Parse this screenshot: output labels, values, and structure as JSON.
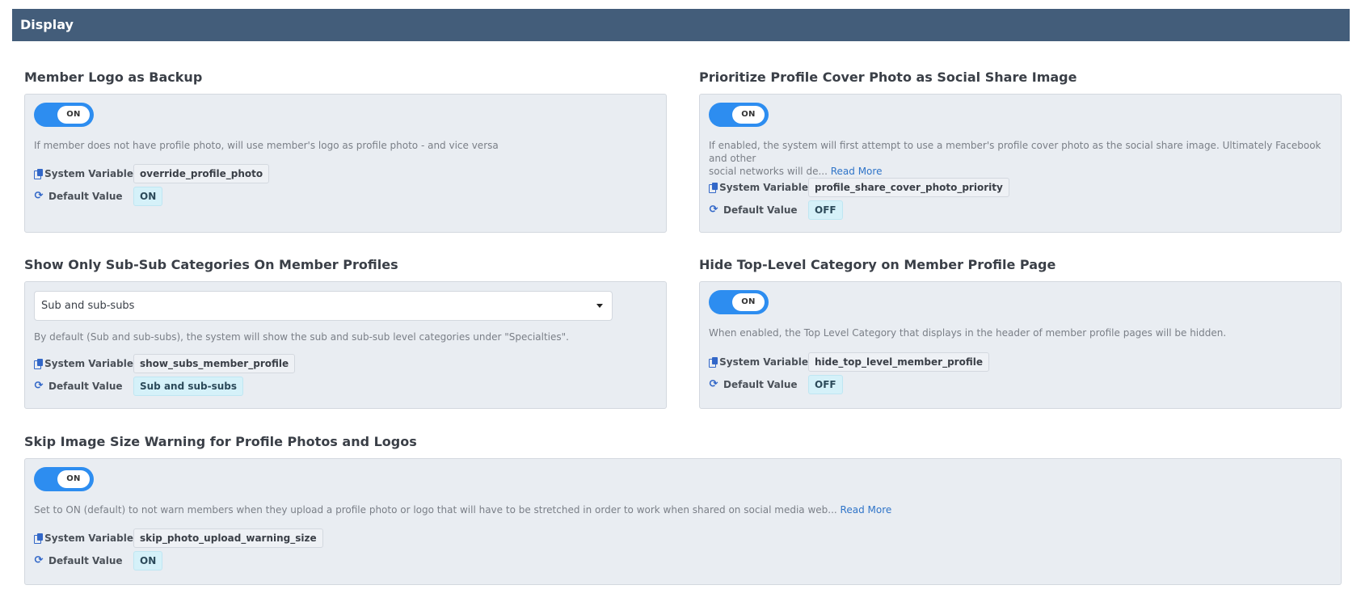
{
  "header": {
    "title": "Display"
  },
  "labels": {
    "system_variable": "System Variable",
    "default_value": "Default Value"
  },
  "settings": {
    "member_logo": {
      "title": "Member Logo as Backup",
      "toggle": "ON",
      "description": "If member does not have profile photo, will use member's logo as profile photo - and vice versa",
      "variable": "override_profile_photo",
      "default": "ON"
    },
    "cover_photo": {
      "title": "Prioritize Profile Cover Photo as Social Share Image",
      "toggle": "ON",
      "description_line1": "If enabled, the system will first attempt to use a member's profile cover photo as the social share image. Ultimately Facebook and other",
      "description_line2": "social networks will de...",
      "read_more": "Read More",
      "variable": "profile_share_cover_photo_priority",
      "default": "OFF"
    },
    "sub_sub": {
      "title": "Show Only Sub-Sub Categories On Member Profiles",
      "select_value": "Sub and sub-subs",
      "description": "By default (Sub and sub-subs), the system will show the sub and sub-sub level categories under \"Specialties\".",
      "variable": "show_subs_member_profile",
      "default": "Sub and sub-subs"
    },
    "hide_top": {
      "title": "Hide Top-Level Category on Member Profile Page",
      "toggle": "ON",
      "description": "When enabled, the Top Level Category that displays in the header of member profile pages will be hidden.",
      "variable": "hide_top_level_member_profile",
      "default": "OFF"
    },
    "skip_warning": {
      "title": "Skip Image Size Warning for Profile Photos and Logos",
      "toggle": "ON",
      "description": "Set to ON (default) to not warn members when they upload a profile photo or logo that will have to be stretched in order to work when shared on social media web...",
      "read_more": "Read More",
      "variable": "skip_photo_upload_warning_size",
      "default": "ON"
    }
  },
  "icons": {
    "system_variable": "copy-icon",
    "default_value": "refresh-icon"
  },
  "colors": {
    "header_bg": "#435d7a",
    "toggle_on": "#2d8df0",
    "card_bg": "#e9edf2",
    "link": "#2f74c8",
    "default_badge_bg": "#d5f1f9"
  }
}
